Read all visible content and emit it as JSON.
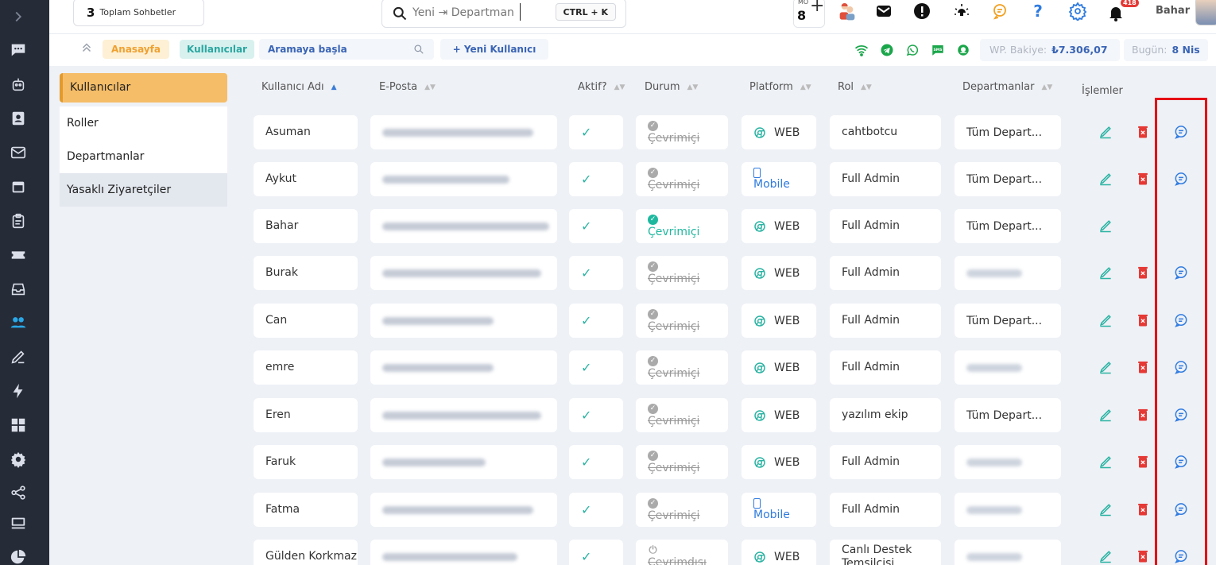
{
  "topbar": {
    "chat_count": "3",
    "chat_label": "Toplam Sohbetler",
    "search_text": "Yeni ⇥ Departman",
    "shortcut": "CTRL + K",
    "mo_label": "MO",
    "mo_value": "8",
    "plus_label": "+",
    "notification_badge": "418",
    "username": "Bahar"
  },
  "subbar": {
    "breadcrumb_home": "Anasayfa",
    "breadcrumb_current": "Kullanıcılar",
    "search_placeholder": "Aramaya başla",
    "new_user_label": "+ Yeni Kullanıcı",
    "balance_label": "WP. Bakiye:",
    "balance_value": "₺7.306,07",
    "today_label": "Bugün:",
    "today_value": "8 Nis"
  },
  "sidemenu": {
    "items": [
      {
        "label": "Kullanıcılar"
      },
      {
        "label": "Roller"
      },
      {
        "label": "Departmanlar"
      },
      {
        "label": "Yasaklı Ziyaretçiler"
      }
    ]
  },
  "table": {
    "headers": {
      "username": "Kullanıcı Adı",
      "email": "E-Posta",
      "active": "Aktif?",
      "status": "Durum",
      "platform": "Platform",
      "role": "Rol",
      "departments": "Departmanlar",
      "actions": "İşlemler"
    },
    "check_symbol": "✓",
    "status_offline": "Çevrimiçi",
    "status_online": "Çevrimiçi",
    "status_away": "Çevrimdışı",
    "rows": [
      {
        "name": "Asuman",
        "platform": "WEB",
        "role": "cahtbotcu",
        "departments": "Tüm Depart..."
      },
      {
        "name": "Aykut",
        "platform": "Mobile",
        "role": "Full Admin",
        "departments": "Tüm Depart..."
      },
      {
        "name": "Bahar",
        "platform": "WEB",
        "role": "Full Admin",
        "departments": "Tüm Depart..."
      },
      {
        "name": "Burak",
        "platform": "WEB",
        "role": "Full Admin",
        "departments": ""
      },
      {
        "name": "Can",
        "platform": "WEB",
        "role": "Full Admin",
        "departments": "Tüm Depart..."
      },
      {
        "name": "emre",
        "platform": "WEB",
        "role": "Full Admin",
        "departments": ""
      },
      {
        "name": "Eren",
        "platform": "WEB",
        "role": "yazılım ekip",
        "departments": "Tüm Depart..."
      },
      {
        "name": "Faruk",
        "platform": "WEB",
        "role": "Full Admin",
        "departments": ""
      },
      {
        "name": "Fatma",
        "platform": "Mobile",
        "role": "Full Admin",
        "departments": ""
      },
      {
        "name": "Gülden Korkmaz",
        "platform": "WEB",
        "role": "Canlı Destek Temsilcisi",
        "departments": ""
      }
    ]
  },
  "colors": {
    "nav_bg": "#262b38",
    "accent_orange": "#f5bd68",
    "accent_teal": "#2bb3a3",
    "link_blue": "#3a64b5",
    "delete_red": "#e53935",
    "highlight_red": "#e50914"
  }
}
